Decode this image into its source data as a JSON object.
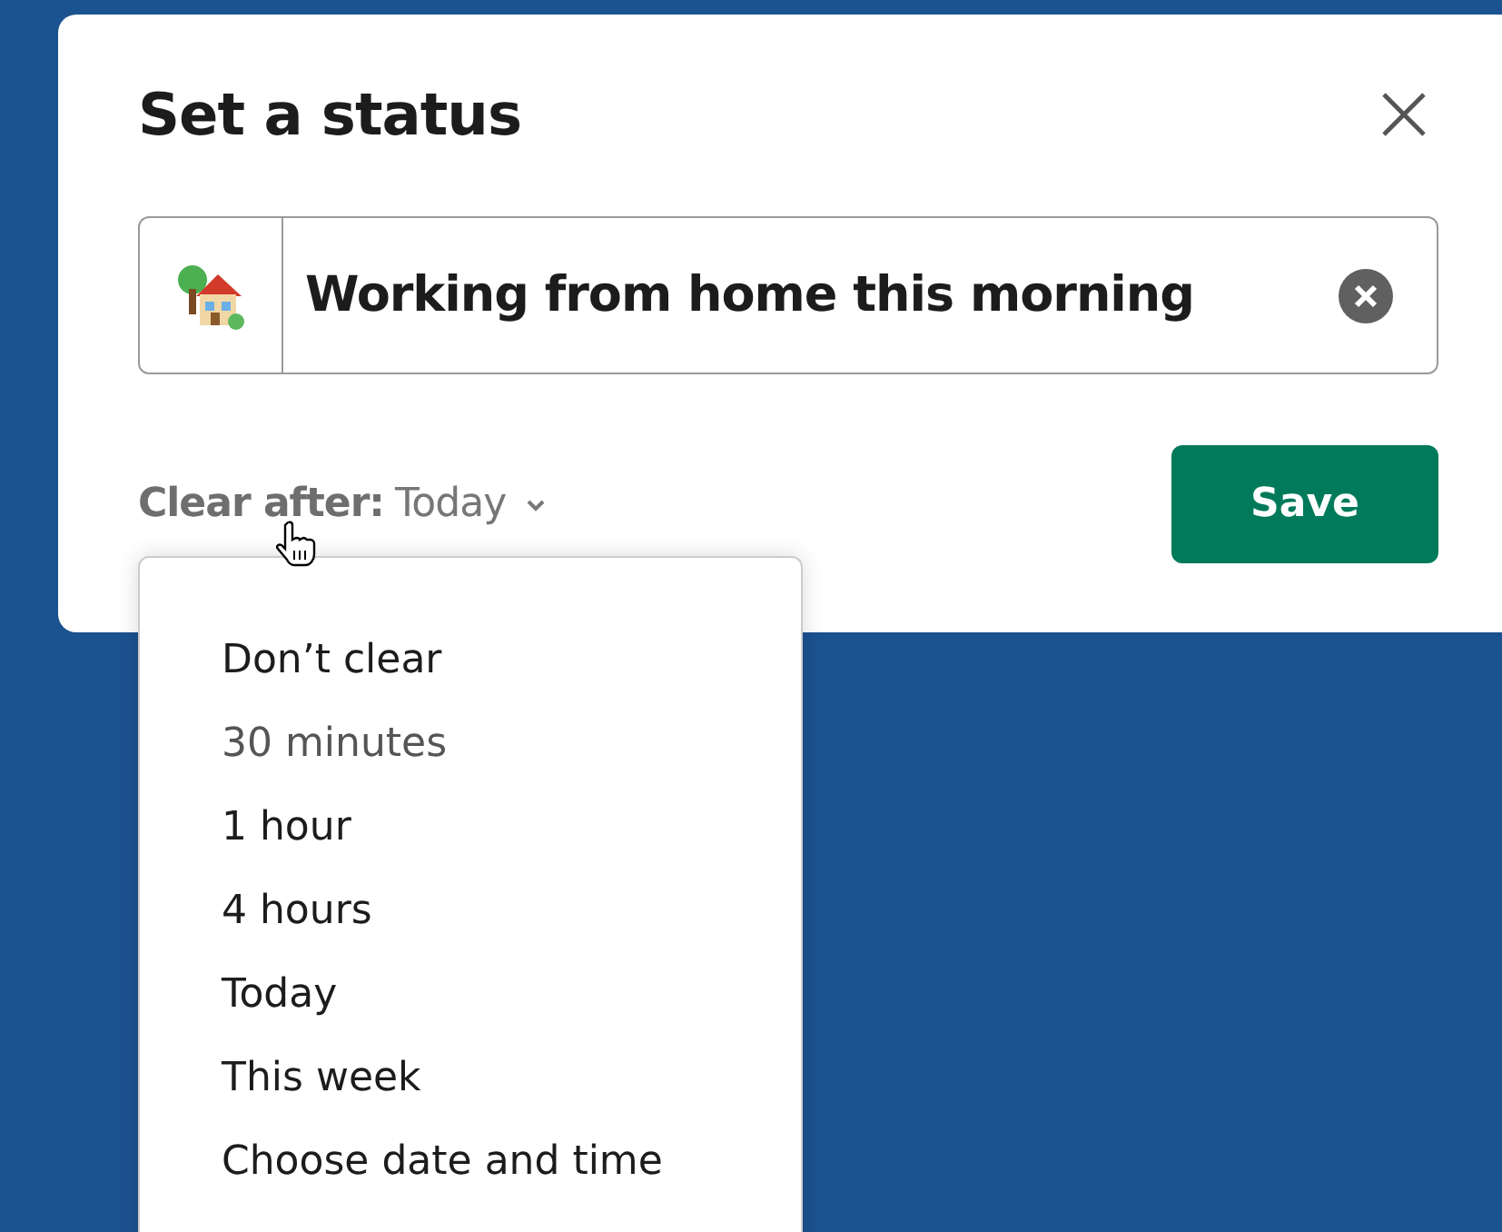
{
  "dialog": {
    "title": "Set a status",
    "status_field": {
      "value": "Working from home this morning"
    },
    "clear_after": {
      "label": "Clear after:",
      "value": "Today"
    },
    "save_button": "Save"
  },
  "clear_menu": {
    "items": [
      {
        "label": "Don’t clear",
        "hovered": false
      },
      {
        "label": "30 minutes",
        "hovered": true
      },
      {
        "label": "1 hour",
        "hovered": false
      },
      {
        "label": "4 hours",
        "hovered": false
      },
      {
        "label": "Today",
        "hovered": false
      },
      {
        "label": "This week",
        "hovered": false
      },
      {
        "label": "Choose date and time",
        "hovered": false
      }
    ]
  }
}
